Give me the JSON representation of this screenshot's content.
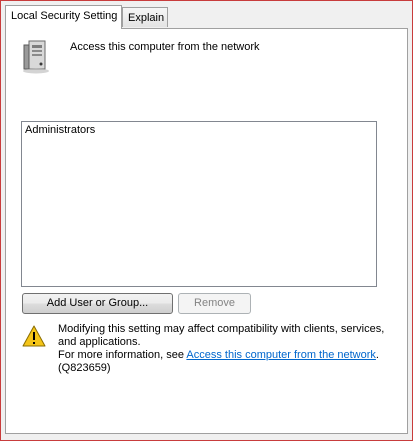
{
  "tabs": [
    {
      "label": "Local Security Setting",
      "active": true
    },
    {
      "label": "Explain",
      "active": false
    }
  ],
  "setting": {
    "icon": "server-icon",
    "title": "Access this computer from the network"
  },
  "members": [
    "Administrators"
  ],
  "buttons": {
    "add_label": "Add User or Group...",
    "remove_label": "Remove",
    "remove_enabled": false
  },
  "warning": {
    "icon": "warning-icon",
    "line1": "Modifying this setting may affect compatibility with clients, services, and applications.",
    "more_prefix": "For more information, see ",
    "link_text": "Access this computer from the network",
    "more_suffix": ".",
    "kb": "(Q823659)"
  },
  "colors": {
    "window_border": "#c83c3c",
    "link": "#0066cc"
  }
}
